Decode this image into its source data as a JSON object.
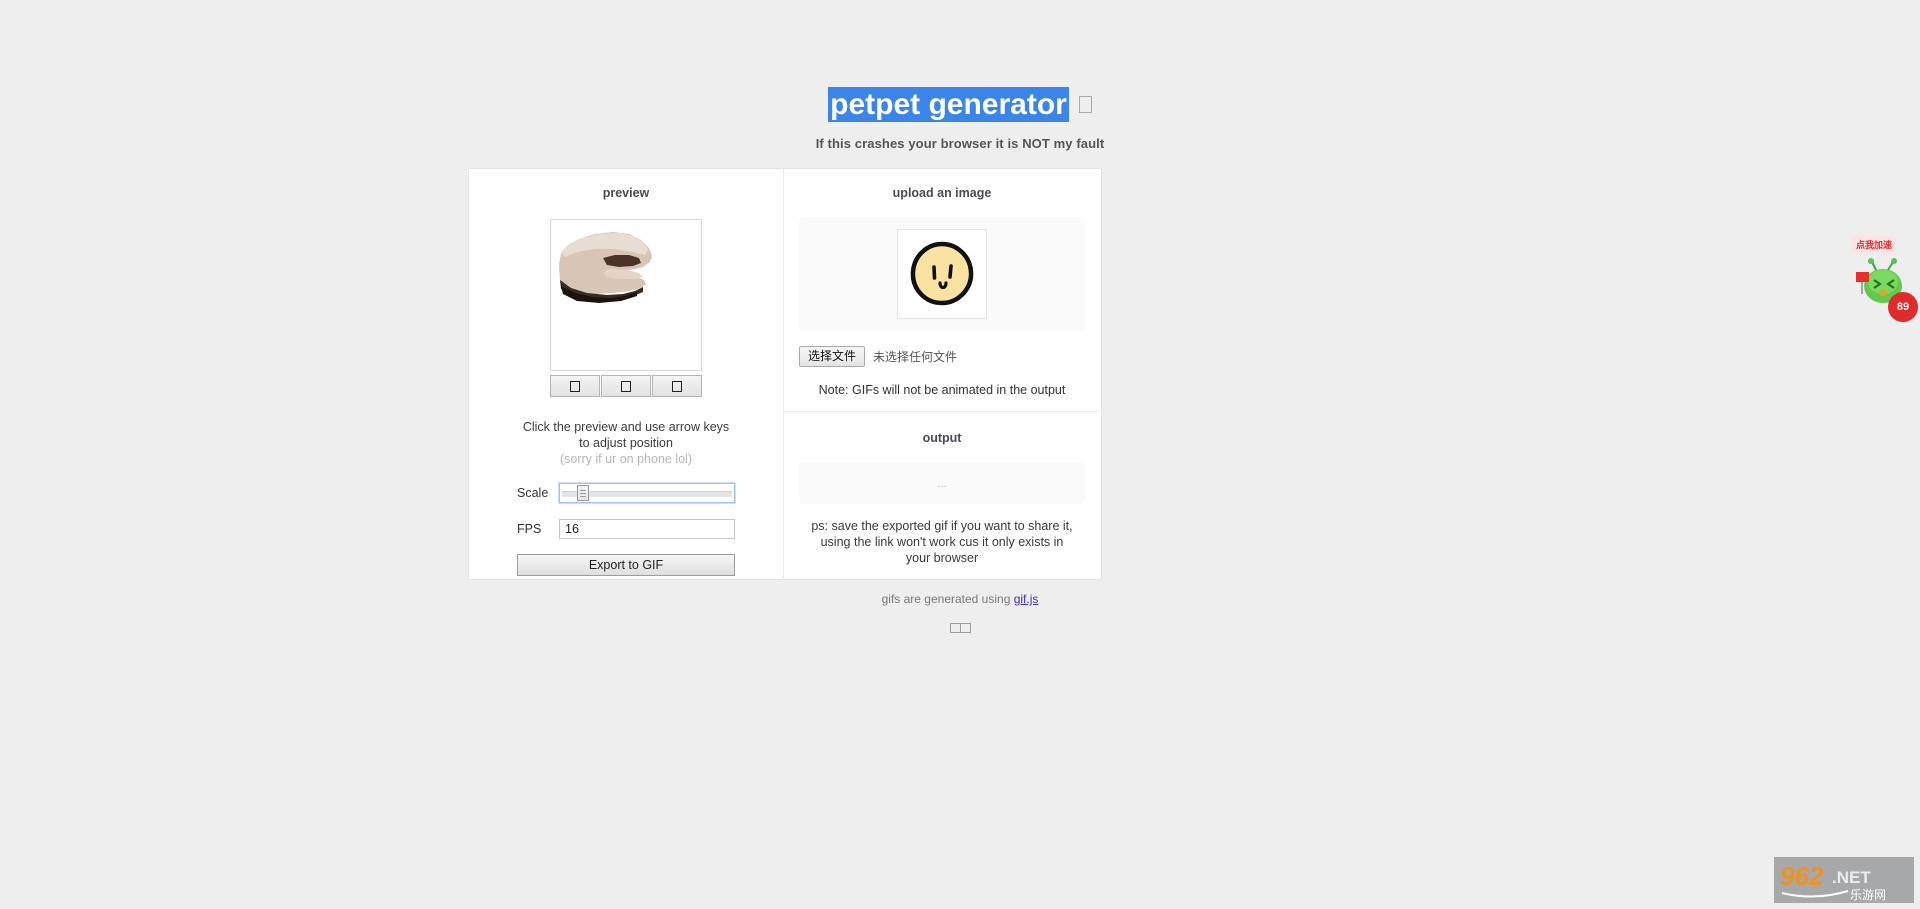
{
  "page": {
    "title": "petpet generator",
    "title_missing_glyph": "tofu-box",
    "subtitle": "If this crashes your browser it is NOT my fault",
    "background_color": "#eeeeee",
    "selection_color": "#3b84e8"
  },
  "preview": {
    "heading": "preview",
    "nudge_buttons": [
      {
        "name": "nudge-button-1",
        "label": ""
      },
      {
        "name": "nudge-button-2",
        "label": ""
      },
      {
        "name": "nudge-button-3",
        "label": ""
      }
    ],
    "hint_line1": "Click the preview and use",
    "hint_line2": "arrow keys to adjust position",
    "hint_line3": "(sorry if ur on phone lol)",
    "controls": {
      "scale_label": "Scale",
      "scale_value": 17,
      "scale_min": 0,
      "scale_max": 100,
      "fps_label": "FPS",
      "fps_value": "16",
      "export_label": "Export to GIF"
    }
  },
  "upload": {
    "heading": "upload an image",
    "file_button_label": "选择文件",
    "file_status": "未选择任何文件",
    "note": "Note: GIFs will not be animated in the output"
  },
  "output": {
    "heading": "output",
    "placeholder": "...",
    "ps_line1": "ps: save the exported gif if you want to share it, using",
    "ps_line2": "the link won't work cus it only exists in your browser"
  },
  "footer": {
    "text_before_link": "gifs are generated using ",
    "link_label": "gif.js",
    "link_color": "#3b2fd0"
  },
  "ad_widget": {
    "bubble_text": "点我加速",
    "badge_count": "89"
  },
  "watermark": {
    "number": "962",
    "domain": ".NET",
    "chinese": "乐游网"
  }
}
